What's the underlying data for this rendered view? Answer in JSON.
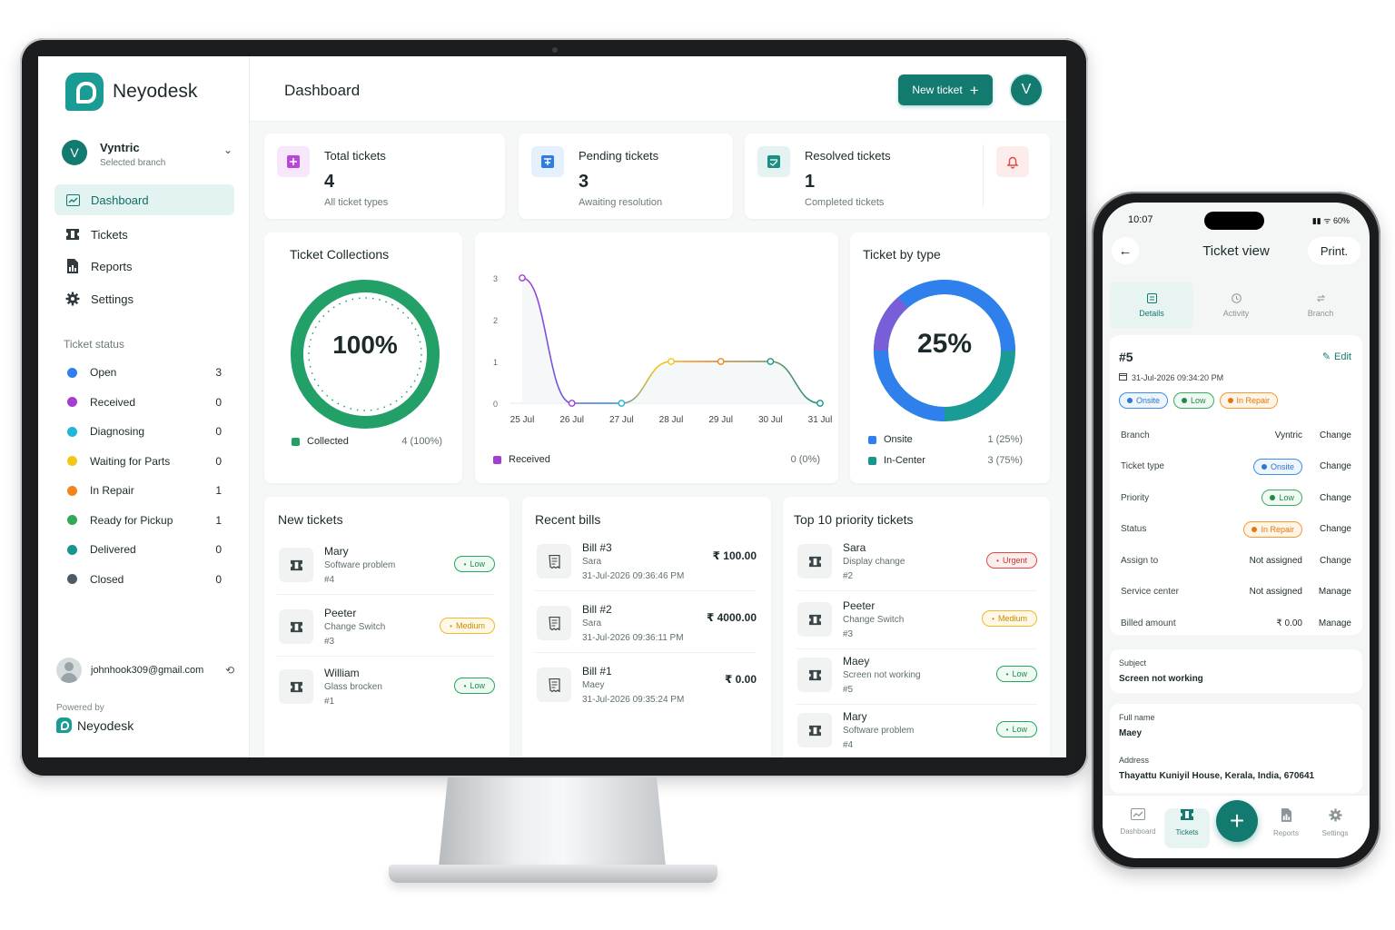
{
  "desktop": {
    "brand": "Neyodesk",
    "page_title": "Dashboard",
    "new_ticket_label": "New ticket",
    "user_initial": "V",
    "branch": {
      "initial": "V",
      "name": "Vyntric",
      "sub": "Selected branch"
    },
    "nav": [
      {
        "label": "Dashboard"
      },
      {
        "label": "Tickets"
      },
      {
        "label": "Reports"
      },
      {
        "label": "Settings"
      }
    ],
    "status_section": "Ticket status",
    "statuses": [
      {
        "label": "Open",
        "count": "3",
        "color": "#2f80ed"
      },
      {
        "label": "Received",
        "count": "0",
        "color": "#a23fd1"
      },
      {
        "label": "Diagnosing",
        "count": "0",
        "color": "#22b5d8"
      },
      {
        "label": "Waiting for Parts",
        "count": "0",
        "color": "#f5c518"
      },
      {
        "label": "In Repair",
        "count": "1",
        "color": "#f5841f"
      },
      {
        "label": "Ready for Pickup",
        "count": "1",
        "color": "#34a853"
      },
      {
        "label": "Delivered",
        "count": "0",
        "color": "#17968c"
      },
      {
        "label": "Closed",
        "count": "0",
        "color": "#4f5a66"
      }
    ],
    "user_email": "johnhook309@gmail.com",
    "powered_by": "Powered by",
    "powered_brand": "Neyodesk",
    "stats": [
      {
        "label": "Total tickets",
        "value": "4",
        "sub": "All ticket types",
        "color": "#b649d8",
        "bg": "#f6e7fb"
      },
      {
        "label": "Pending tickets",
        "value": "3",
        "sub": "Awaiting resolution",
        "color": "#2f7de1",
        "bg": "#e6effc"
      },
      {
        "label": "Resolved tickets",
        "value": "1",
        "sub": "Completed tickets",
        "color": "#1a8f84",
        "bg": "#e4f3f1"
      }
    ],
    "collections": {
      "title": "Ticket Collections",
      "percent": "100%",
      "legend_label": "Collected",
      "legend_value": "4 (100%)",
      "color": "#23a068"
    },
    "trend": {
      "legend_label": "Received",
      "legend_value": "0 (0%)"
    },
    "by_type": {
      "title": "Ticket by type",
      "percent": "25%",
      "items": [
        {
          "label": "Onsite",
          "value": "1 (25%)",
          "color": "#2f80ed"
        },
        {
          "label": "In-Center",
          "value": "3 (75%)",
          "color": "#17968c"
        }
      ]
    },
    "new_tickets": {
      "title": "New tickets",
      "items": [
        {
          "name": "Mary",
          "desc": "Software problem",
          "num": "#4",
          "priority": "Low",
          "level": "low"
        },
        {
          "name": "Peeter",
          "desc": "Change Switch",
          "num": "#3",
          "priority": "Medium",
          "level": "medium"
        },
        {
          "name": "William",
          "desc": "Glass brocken",
          "num": "#1",
          "priority": "Low",
          "level": "low"
        }
      ]
    },
    "recent_bills": {
      "title": "Recent bills",
      "items": [
        {
          "name": "Bill #3",
          "customer": "Sara",
          "date": "31-Jul-2026 09:36:46 PM",
          "amount": "₹ 100.00"
        },
        {
          "name": "Bill #2",
          "customer": "Sara",
          "date": "31-Jul-2026 09:36:11 PM",
          "amount": "₹ 4000.00"
        },
        {
          "name": "Bill #1",
          "customer": "Maey",
          "date": "31-Jul-2026 09:35:24 PM",
          "amount": "₹ 0.00"
        }
      ]
    },
    "priority_tickets": {
      "title": "Top 10 priority tickets",
      "items": [
        {
          "name": "Sara",
          "desc": "Display change",
          "num": "#2",
          "priority": "Urgent",
          "level": "urgent"
        },
        {
          "name": "Peeter",
          "desc": "Change Switch",
          "num": "#3",
          "priority": "Medium",
          "level": "medium"
        },
        {
          "name": "Maey",
          "desc": "Screen not working",
          "num": "#5",
          "priority": "Low",
          "level": "low"
        },
        {
          "name": "Mary",
          "desc": "Software problem",
          "num": "#4",
          "priority": "Low",
          "level": "low"
        }
      ]
    }
  },
  "chart_data": {
    "type": "line",
    "x": [
      "25 Jul",
      "26 Jul",
      "27 Jul",
      "28 Jul",
      "29 Jul",
      "30 Jul",
      "31 Jul"
    ],
    "ylim": [
      0,
      3
    ],
    "yticks": [
      "0",
      "1",
      "2",
      "3"
    ],
    "series": [
      {
        "name": "Received",
        "values": [
          3,
          0,
          0,
          1,
          1,
          1,
          0
        ]
      }
    ]
  },
  "phone": {
    "time": "10:07",
    "status_bar": "60%",
    "title": "Ticket view",
    "print_label": "Print.",
    "tabs": [
      {
        "label": "Details"
      },
      {
        "label": "Activity"
      },
      {
        "label": "Branch"
      }
    ],
    "ticket_no": "#5",
    "edit_label": "Edit",
    "datetime": "31-Jul-2026 09:34:20 PM",
    "chips": [
      "Onsite",
      "Low",
      "In Repair"
    ],
    "rows": [
      {
        "label": "Branch",
        "value": "Vyntric",
        "action": "Change"
      },
      {
        "label": "Ticket type",
        "value": "Onsite",
        "action": "Change"
      },
      {
        "label": "Priority",
        "value": "Low",
        "action": "Change"
      },
      {
        "label": "Status",
        "value": "In Repair",
        "action": "Change"
      },
      {
        "label": "Assign to",
        "value": "Not assigned",
        "action": "Change"
      },
      {
        "label": "Service center",
        "value": "Not assigned",
        "action": "Manage"
      },
      {
        "label": "Billed amount",
        "value": "₹ 0.00",
        "action": "Manage"
      }
    ],
    "subject_label": "Subject",
    "subject_value": "Screen not working",
    "fullname_label": "Full name",
    "fullname_value": "Maey",
    "address_label": "Address",
    "address_value": "Thayattu Kuniyil House, Kerala, India, 670641",
    "bottom_nav": [
      {
        "label": "Dashboard"
      },
      {
        "label": "Tickets"
      },
      {
        "label": "Reports"
      },
      {
        "label": "Settings"
      }
    ]
  }
}
